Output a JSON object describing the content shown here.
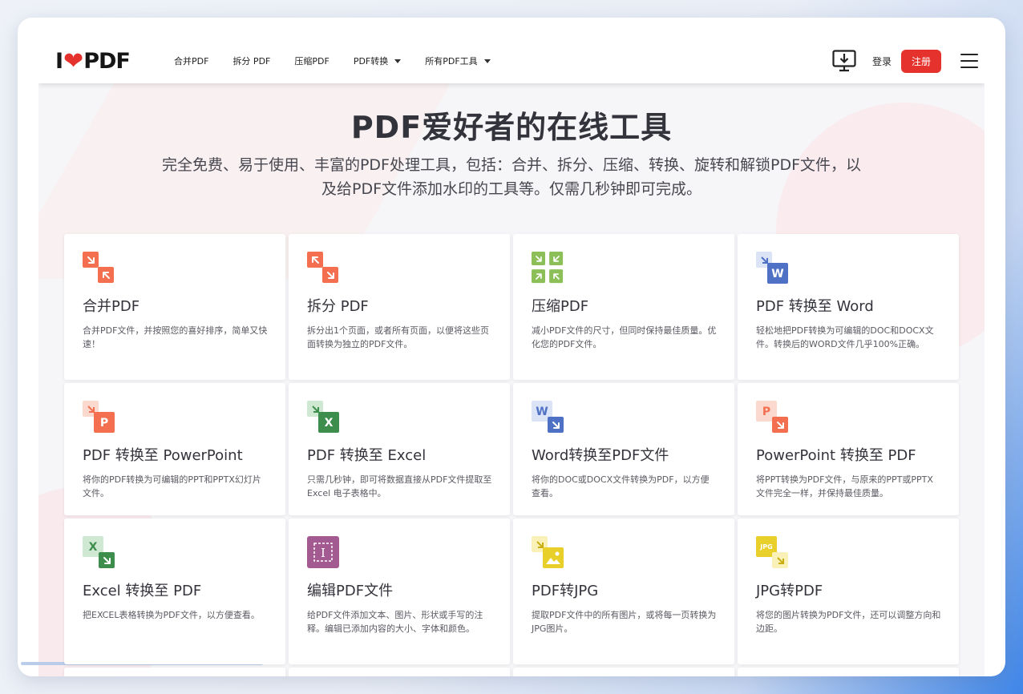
{
  "header": {
    "logo": {
      "left": "I",
      "right": "PDF"
    },
    "nav": [
      {
        "label": "合并PDF",
        "dropdown": false
      },
      {
        "label": "拆分 PDF",
        "dropdown": false
      },
      {
        "label": "压缩PDF",
        "dropdown": false
      },
      {
        "label": "PDF转换",
        "dropdown": true
      },
      {
        "label": "所有PDF工具",
        "dropdown": true
      }
    ],
    "login_label": "登录",
    "signup_label": "注册"
  },
  "hero": {
    "title": "PDF爱好者的在线工具",
    "subtitle": "完全免费、易于使用、丰富的PDF处理工具，包括：合并、拆分、压缩、转换、旋转和解锁PDF文件，以及给PDF文件添加水印的工具等。仅需几秒钟即可完成。"
  },
  "tools": [
    {
      "title": "合并PDF",
      "desc": "合并PDF文件，并按照您的喜好排序，简单又快速！",
      "icon": "merge-icon"
    },
    {
      "title": "拆分 PDF",
      "desc": "拆分出1个页面，或者所有页面，以便将这些页面转换为独立的PDF文件。",
      "icon": "split-icon"
    },
    {
      "title": "压缩PDF",
      "desc": "减小PDF文件的尺寸，但同时保持最佳质量。优化您的PDF文件。",
      "icon": "compress-icon"
    },
    {
      "title": "PDF 转换至 Word",
      "desc": "轻松地把PDF转换为可编辑的DOC和DOCX文件。转换后的WORD文件几乎100%正确。",
      "icon": "pdf-to-word-icon"
    },
    {
      "title": "PDF 转换至 PowerPoint",
      "desc": "将你的PDF转换为可编辑的PPT和PPTX幻灯片文件。",
      "icon": "pdf-to-powerpoint-icon"
    },
    {
      "title": "PDF 转换至 Excel",
      "desc": "只需几秒钟，即可将数据直接从PDF文件提取至Excel 电子表格中。",
      "icon": "pdf-to-excel-icon"
    },
    {
      "title": "Word转换至PDF文件",
      "desc": "将你的DOC或DOCX文件转换为PDF，以方便查看。",
      "icon": "word-to-pdf-icon"
    },
    {
      "title": "PowerPoint 转换至 PDF",
      "desc": "将PPT转换为PDF文件，与原来的PPT或PPTX文件完全一样，并保持最佳质量。",
      "icon": "powerpoint-to-pdf-icon"
    },
    {
      "title": "Excel 转换至 PDF",
      "desc": "把EXCEL表格转换为PDF文件，以方便查看。",
      "icon": "excel-to-pdf-icon"
    },
    {
      "title": "编辑PDF文件",
      "desc": "给PDF文件添加文本、图片、形状或手写的注释。编辑已添加内容的大小、字体和颜色。",
      "icon": "edit-pdf-icon"
    },
    {
      "title": "PDF转JPG",
      "desc": "提取PDF文件中的所有图片，或将每一页转换为JPG图片。",
      "icon": "pdf-to-jpg-icon"
    },
    {
      "title": "JPG转PDF",
      "desc": "将您的图片转换为PDF文件，还可以调整方向和边距。",
      "icon": "jpg-to-pdf-icon"
    }
  ],
  "icon_text": {
    "word": "W",
    "ppt": "P",
    "excel": "X",
    "jpg": "JPG"
  },
  "colors": {
    "brand_red": "#e5322d",
    "tile_red": "#f36f4f",
    "tile_green": "#8dbf58",
    "word_blue": "#4f71c5",
    "excel_green": "#3d8d4d",
    "edit_purple": "#a35a90",
    "jpg_yellow": "#e8cf2a"
  }
}
